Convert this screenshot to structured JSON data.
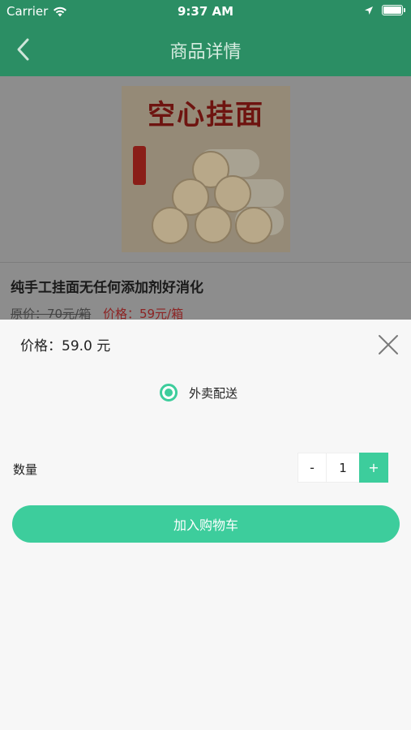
{
  "status_bar": {
    "carrier": "Carrier",
    "time": "9:37 AM"
  },
  "nav": {
    "title": "商品详情"
  },
  "product": {
    "image_title": "空心挂面",
    "name": "纯手工挂面无任何添加剂好消化",
    "original_price": "原价：70元/箱",
    "sale_price": "价格：59元/箱"
  },
  "sheet": {
    "price": "价格：59.0 元",
    "delivery_option": "外卖配送",
    "quantity_label": "数量",
    "minus": "-",
    "quantity": "1",
    "plus": "+",
    "add_to_cart": "加入购物车"
  },
  "colors": {
    "nav_green": "#2b8e64",
    "accent_green": "#3dcd9c",
    "sale_red": "#8d2424"
  },
  "icons": {
    "signal": "wifi-icon",
    "location": "location-arrow-icon",
    "battery": "battery-icon",
    "back": "back-chevron-icon",
    "close": "close-icon"
  }
}
